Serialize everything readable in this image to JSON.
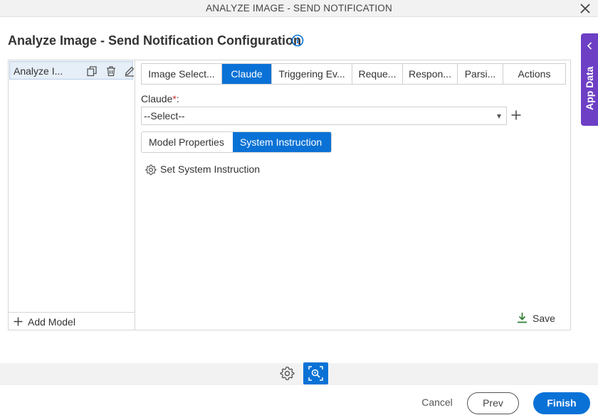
{
  "window": {
    "title": "ANALYZE IMAGE - SEND NOTIFICATION"
  },
  "page": {
    "title": "Analyze Image - Send Notification Configuration"
  },
  "side_tab": {
    "label": "App Data"
  },
  "models": {
    "items": [
      {
        "label": "Analyze I..."
      }
    ],
    "add_label": "Add Model"
  },
  "tabs": [
    {
      "label": "Image Select...",
      "active": false
    },
    {
      "label": "Claude",
      "active": true
    },
    {
      "label": "Triggering Ev...",
      "active": false
    },
    {
      "label": "Reque...",
      "active": false
    },
    {
      "label": "Respon...",
      "active": false
    },
    {
      "label": "Parsi...",
      "active": false
    },
    {
      "label": "Actions",
      "active": false
    }
  ],
  "claude_field": {
    "label": "Claude",
    "required_mark": "*",
    "colon": ":",
    "value": "--Select--"
  },
  "subtabs": [
    {
      "label": "Model Properties",
      "active": false
    },
    {
      "label": "System Instruction",
      "active": true
    }
  ],
  "system_instruction": {
    "label": "Set System Instruction"
  },
  "save": {
    "label": "Save"
  },
  "footer": {
    "cancel": "Cancel",
    "prev": "Prev",
    "finish": "Finish"
  },
  "colors": {
    "accent": "#0a72d6",
    "side_tab": "#6c3fc5",
    "required": "#d0312d",
    "save_icon": "#2e7d32"
  }
}
